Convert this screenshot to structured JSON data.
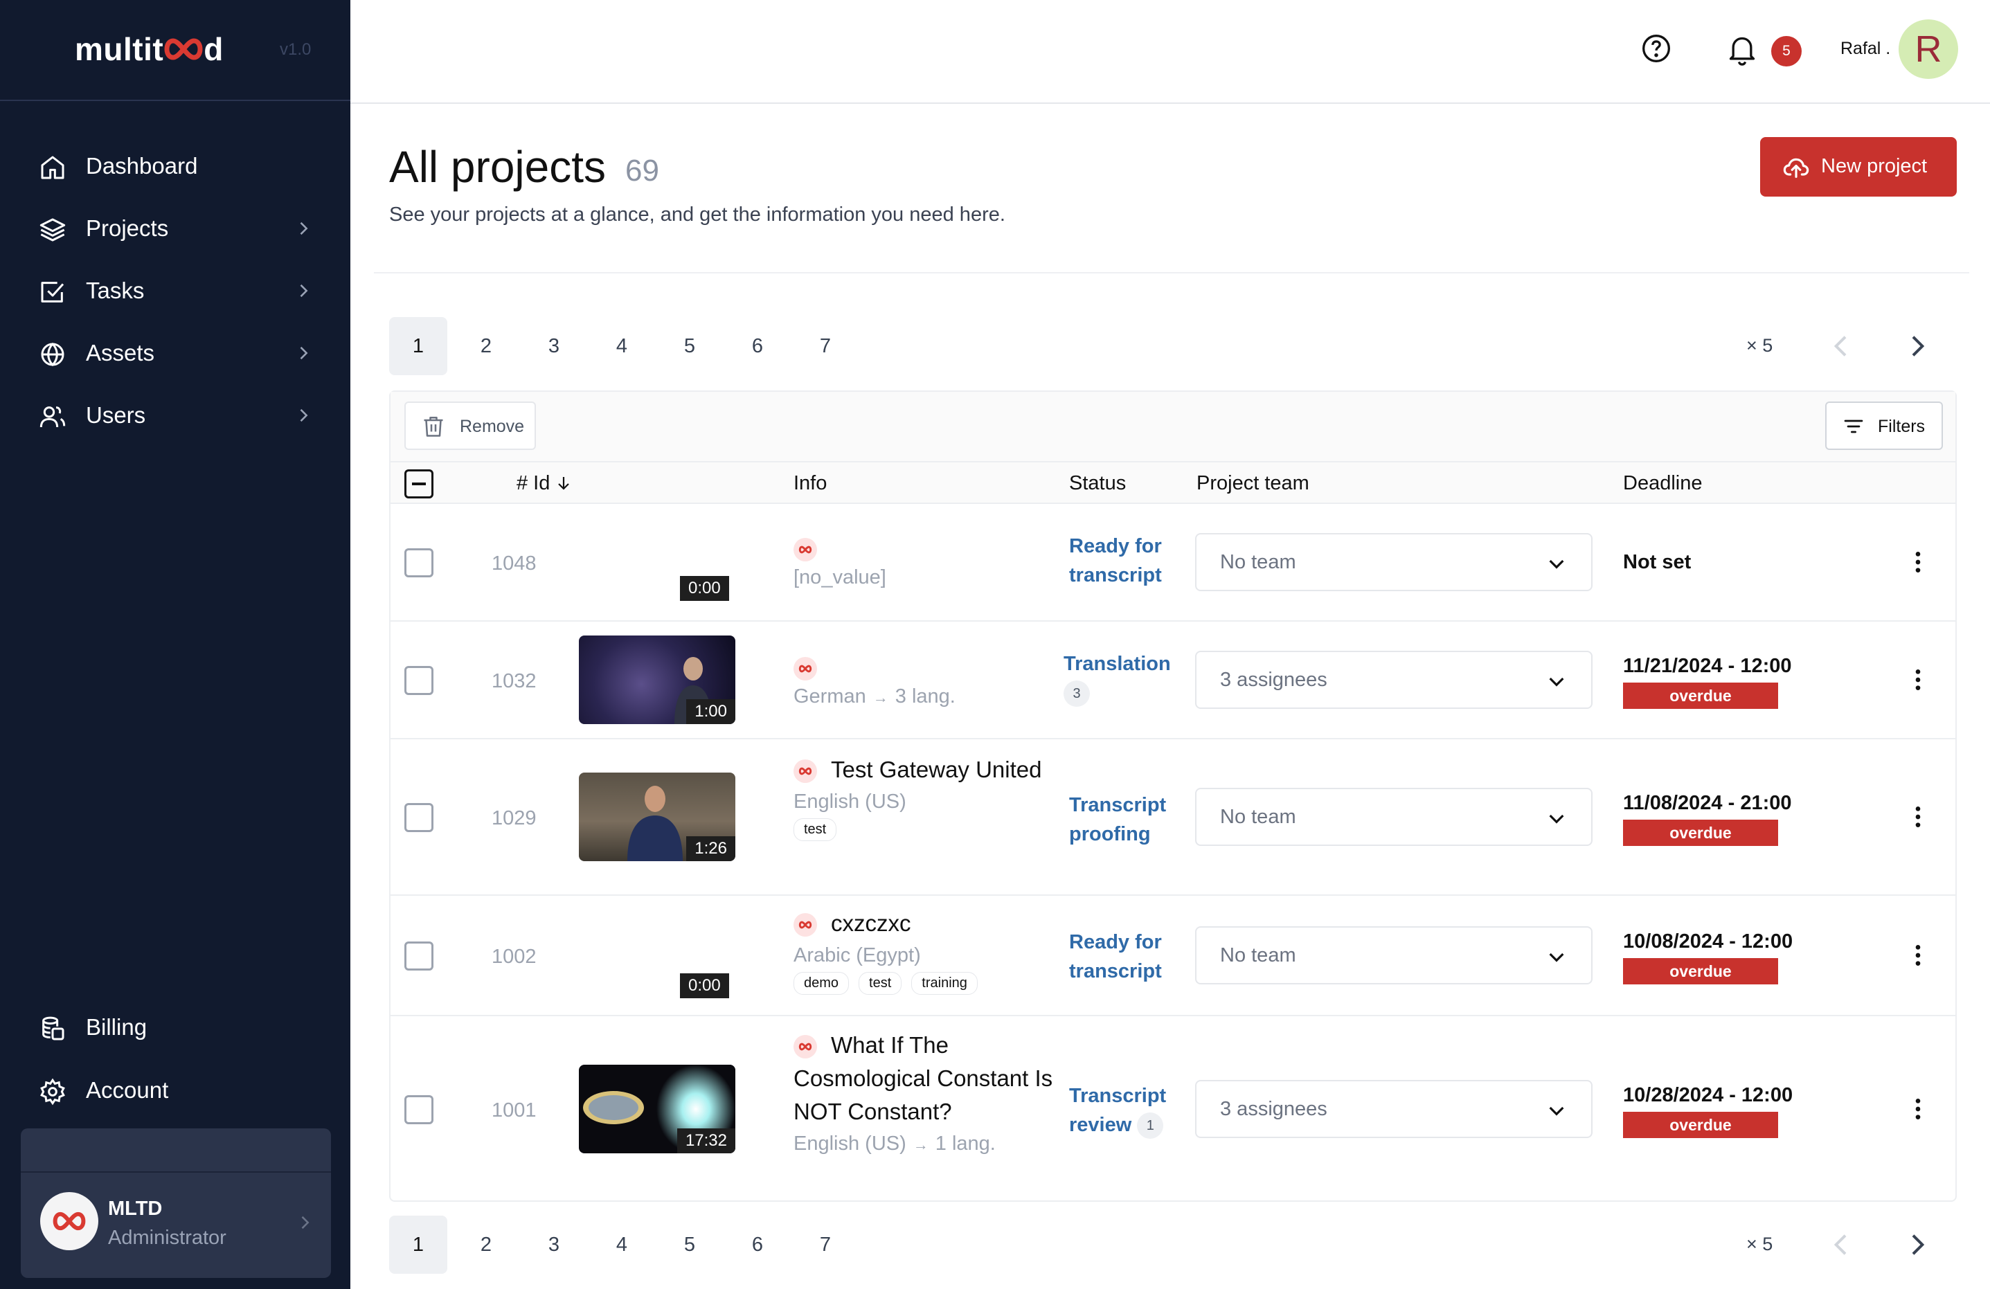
{
  "brand": {
    "name_left": "multit",
    "name_right": "d",
    "version": "v1.0"
  },
  "nav": [
    {
      "label": "Dashboard",
      "icon": "home-icon"
    },
    {
      "label": "Projects",
      "icon": "layers-icon"
    },
    {
      "label": "Tasks",
      "icon": "task-check-icon"
    },
    {
      "label": "Assets",
      "icon": "globe-icon"
    },
    {
      "label": "Users",
      "icon": "users-icon"
    }
  ],
  "nav_bottom": [
    {
      "label": "Billing",
      "icon": "billing-icon"
    },
    {
      "label": "Account",
      "icon": "gear-icon"
    }
  ],
  "user_card": {
    "name": "MLTD",
    "role": "Administrator"
  },
  "topbar": {
    "notifications": "5",
    "user_name": "Rafal .",
    "avatar_letter": "R"
  },
  "header": {
    "title": "All projects",
    "count": "69",
    "subtitle": "See your projects at a glance, and get the information you need here.",
    "new_button": "New project"
  },
  "pagination": {
    "pages": [
      "1",
      "2",
      "3",
      "4",
      "5",
      "6",
      "7"
    ],
    "active": "1",
    "per_page": "× 5"
  },
  "toolbar": {
    "remove": "Remove",
    "filters": "Filters"
  },
  "columns": {
    "id": "# Id",
    "info": "Info",
    "status": "Status",
    "team": "Project team",
    "deadline": "Deadline"
  },
  "rows": [
    {
      "id": "1048",
      "duration": "0:00",
      "title": "",
      "lang": "[no_value]",
      "lang_extra": "",
      "tags": [],
      "status": "Ready for transcript",
      "status_count": "",
      "team": "No team",
      "deadline": "Not set",
      "overdue": ""
    },
    {
      "id": "1032",
      "duration": "1:00",
      "title": "",
      "lang": "German",
      "lang_extra": "3 lang.",
      "tags": [],
      "status": "Translation",
      "status_count": "3",
      "team": "3 assignees",
      "deadline": "11/21/2024 - 12:00",
      "overdue": "overdue"
    },
    {
      "id": "1029",
      "duration": "1:26",
      "title": "Test Gateway United",
      "lang": "English (US)",
      "lang_extra": "",
      "tags": [
        "test"
      ],
      "status": "Transcript proofing",
      "status_count": "",
      "team": "No team",
      "deadline": "11/08/2024 - 21:00",
      "overdue": "overdue"
    },
    {
      "id": "1002",
      "duration": "0:00",
      "title": "cxzczxc",
      "lang": "Arabic (Egypt)",
      "lang_extra": "",
      "tags": [
        "demo",
        "test",
        "training"
      ],
      "status": "Ready for transcript",
      "status_count": "",
      "team": "No team",
      "deadline": "10/08/2024 - 12:00",
      "overdue": "overdue"
    },
    {
      "id": "1001",
      "duration": "17:32",
      "title": "What If The Cosmological Constant Is NOT Constant?",
      "lang": "English (US)",
      "lang_extra": "1 lang.",
      "tags": [],
      "status": "Transcript review",
      "status_count": "1",
      "team": "3 assignees",
      "deadline": "10/28/2024 - 12:00",
      "overdue": "overdue"
    }
  ],
  "colors": {
    "sidebar": "#111a2e",
    "accent": "#c8322d",
    "status": "#2f6aa8"
  }
}
